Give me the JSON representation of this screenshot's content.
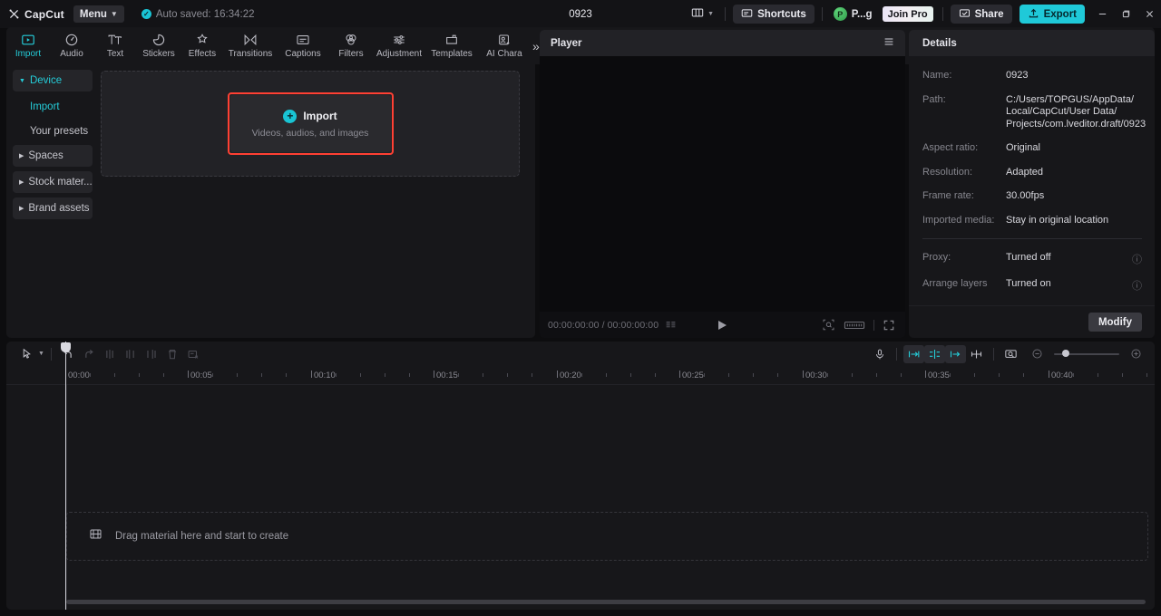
{
  "titlebar": {
    "brand": "CapCut",
    "menu_label": "Menu",
    "autosave": "Auto saved: 16:34:22",
    "project_title": "0923",
    "shortcuts_label": "Shortcuts",
    "user_initial": "P",
    "user_name": "P...g",
    "join_pro_label": "Join Pro",
    "share_label": "Share",
    "export_label": "Export",
    "minimize": "─",
    "restore": "❐",
    "close": "✕"
  },
  "tabs": [
    {
      "label": "Import",
      "icon": "import-icon",
      "active": true
    },
    {
      "label": "Audio",
      "icon": "audio-icon",
      "active": false
    },
    {
      "label": "Text",
      "icon": "text-icon",
      "active": false
    },
    {
      "label": "Stickers",
      "icon": "stickers-icon",
      "active": false
    },
    {
      "label": "Effects",
      "icon": "effects-icon",
      "active": false
    },
    {
      "label": "Transitions",
      "icon": "transitions-icon",
      "active": false
    },
    {
      "label": "Captions",
      "icon": "captions-icon",
      "active": false
    },
    {
      "label": "Filters",
      "icon": "filters-icon",
      "active": false
    },
    {
      "label": "Adjustment",
      "icon": "adjustment-icon",
      "active": false
    },
    {
      "label": "Templates",
      "icon": "templates-icon",
      "active": false
    },
    {
      "label": "AI Chara",
      "icon": "ai-character-icon",
      "active": false
    }
  ],
  "tabs_more": "»",
  "sidebar": {
    "items": [
      {
        "label": "Device",
        "type": "group",
        "expanded": true,
        "active": true
      },
      {
        "label": "Import",
        "type": "sub",
        "active": true
      },
      {
        "label": "Your presets",
        "type": "sub",
        "active": false
      },
      {
        "label": "Spaces",
        "type": "group",
        "expanded": false,
        "active": false
      },
      {
        "label": "Stock mater...",
        "type": "group",
        "expanded": false,
        "active": false
      },
      {
        "label": "Brand assets",
        "type": "group",
        "expanded": false,
        "active": false
      }
    ]
  },
  "import_zone": {
    "button_label": "Import",
    "hint": "Videos, audios, and images",
    "plus": "+",
    "highlight_color": "#ff4033"
  },
  "player": {
    "title": "Player",
    "current_time": "00:00:00:00",
    "total_time": "00:00:00:00",
    "timecode": "00:00:00:00 / 00:00:00:00"
  },
  "details": {
    "title": "Details",
    "rows": [
      {
        "label": "Name:",
        "value": "0923"
      },
      {
        "label": "Aspect ratio:",
        "value": "Original"
      },
      {
        "label": "Resolution:",
        "value": "Adapted"
      },
      {
        "label": "Frame rate:",
        "value": "30.00fps"
      },
      {
        "label": "Imported media:",
        "value": "Stay in original location"
      }
    ],
    "path_label": "Path:",
    "path_lines": [
      "C:/Users/TOPGUS/AppData/",
      "Local/CapCut/User Data/",
      "Projects/com.lveditor.draft/0923"
    ],
    "proxy_label": "Proxy:",
    "proxy_value": "Turned off",
    "arrange_label": "Arrange layers",
    "arrange_value": "Turned on",
    "help_glyph": "ⓘ",
    "modify_label": "Modify"
  },
  "timeline": {
    "tools": [
      {
        "name": "select-tool",
        "enabled": true
      },
      {
        "name": "undo-tool",
        "enabled": true
      },
      {
        "name": "redo-tool",
        "enabled": false
      },
      {
        "name": "split-tool",
        "enabled": false
      },
      {
        "name": "trim-left-tool",
        "enabled": false
      },
      {
        "name": "trim-right-tool",
        "enabled": false
      },
      {
        "name": "delete-tool",
        "enabled": false
      },
      {
        "name": "crop-delete-tool",
        "enabled": false
      }
    ],
    "right_tools": [
      {
        "name": "record-voiceover-icon",
        "state": "normal"
      },
      {
        "name": "snap-left-icon",
        "state": "teal"
      },
      {
        "name": "mirror-icon",
        "state": "teal-active"
      },
      {
        "name": "snap-right-icon",
        "state": "teal"
      },
      {
        "name": "split-marker-icon",
        "state": "normal"
      },
      {
        "name": "preview-render-icon",
        "state": "normal"
      }
    ],
    "zoom_out": "−",
    "zoom_in": "+",
    "ruler_labels": [
      "00:00",
      "00:05",
      "00:10",
      "00:15",
      "00:20",
      "00:25",
      "00:30",
      "00:35",
      "00:40"
    ],
    "drop_hint": "Drag material here and start to create"
  }
}
